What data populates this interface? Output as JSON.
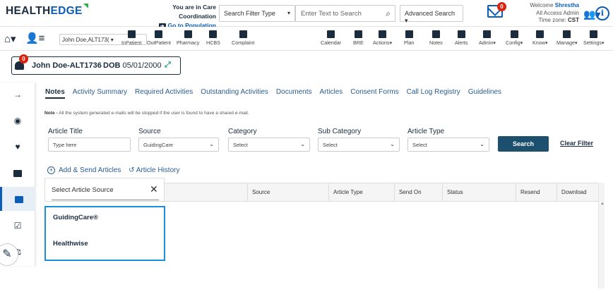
{
  "header": {
    "logo_a": "HEALTH",
    "logo_b": "EDGE",
    "coord_line1": "You are in Care Coordination",
    "coord_line2": "Go to Population Health",
    "filter_type": "Search Filter Type",
    "search_placeholder": "Enter Text to Search",
    "advanced_search": "Advanced Search",
    "mail_count": "0",
    "welcome": "Welcome",
    "user": "Shrestha",
    "role": "All Access Admin",
    "tz_label": "Time zone:",
    "tz": "CST"
  },
  "toolbar": {
    "member": "John Doe,ALT173(",
    "left_items": [
      "InPatient",
      "OutPatient",
      "Pharmacy",
      "HCBS",
      "Complaint"
    ],
    "right_items": [
      "Calendar",
      "BRE",
      "Actions",
      "Plan",
      "Notes",
      "Alerts",
      "Admin",
      "Config",
      "Know",
      "Manage",
      "Settings"
    ]
  },
  "patient": {
    "alert_count": "0",
    "name": "John Doe-ALT1736",
    "dob_label": "DOB",
    "dob": "05/01/2000"
  },
  "tabs": [
    "Notes",
    "Activity Summary",
    "Required Activities",
    "Outstanding Activities",
    "Documents",
    "Articles",
    "Consent Forms",
    "Call Log Registry",
    "Guidelines"
  ],
  "note": {
    "label": "Note -",
    "text": "All the system generated e-mails will be stopped if the user is found to have a shared e-mail."
  },
  "filters": {
    "article_title_label": "Article Title",
    "article_title_placeholder": "Type here",
    "source_label": "Source",
    "source_value": "GuidingCare",
    "category_label": "Category",
    "category_value": "Select",
    "subcategory_label": "Sub Category",
    "subcategory_value": "Select",
    "article_type_label": "Article Type",
    "article_type_value": "Select",
    "search_btn": "Search",
    "clear_btn": "Clear Filter"
  },
  "actions": {
    "add_send": "Add & Send Articles",
    "history": "Article History"
  },
  "grid": {
    "columns": [
      "Source",
      "Article Type",
      "Send On",
      "Status",
      "Resend",
      "Download"
    ]
  },
  "popup": {
    "title": "Select Article Source",
    "items": [
      "GuidingCare®",
      "Healthwise"
    ]
  }
}
